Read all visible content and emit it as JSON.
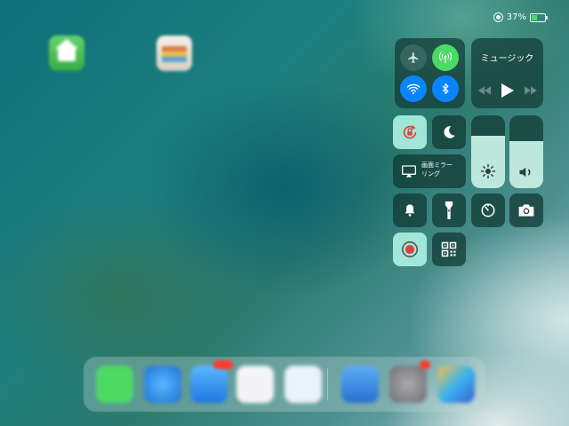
{
  "status_bar": {
    "battery_percent": "37%",
    "battery_level": 0.37,
    "orientation_lock_icon": "orientation-lock-icon",
    "battery_icon": "battery-icon"
  },
  "home_screen": {
    "apps": [
      {
        "name": "Home",
        "icon": "home-app-icon"
      },
      {
        "name": "Wallet",
        "icon": "wallet-app-icon"
      }
    ]
  },
  "control_center": {
    "connectivity": {
      "airplane": {
        "icon": "airplane-icon",
        "on": false
      },
      "cellular": {
        "icon": "cellular-antenna-icon",
        "on": true,
        "color": "#4cd964"
      },
      "wifi": {
        "icon": "wifi-icon",
        "on": true,
        "color": "#0a84ff"
      },
      "bluetooth": {
        "icon": "bluetooth-icon",
        "on": true,
        "color": "#0a84ff"
      }
    },
    "music": {
      "title": "ミュージック",
      "controls": [
        "rewind-icon",
        "play-icon",
        "fast-forward-icon"
      ]
    },
    "orientation_lock": {
      "icon": "rotation-lock-icon",
      "on": true
    },
    "do_not_disturb": {
      "icon": "moon-icon",
      "on": false
    },
    "screen_mirroring": {
      "label": "画面ミラーリング",
      "line1": "画面ミラー",
      "line2": "リング",
      "icon": "screen-mirroring-icon"
    },
    "brightness": {
      "icon": "sun-icon",
      "level": 0.72
    },
    "volume": {
      "icon": "speaker-icon",
      "level": 0.65
    },
    "shortcuts": [
      {
        "icon": "bell-icon"
      },
      {
        "icon": "flashlight-icon"
      },
      {
        "icon": "timer-icon"
      },
      {
        "icon": "camera-icon"
      },
      {
        "icon": "screen-record-icon",
        "on": true
      },
      {
        "icon": "qr-code-icon"
      }
    ],
    "accent_active": "#aaf0e1"
  },
  "dock": {
    "apps": [
      {
        "name": "Messages",
        "color": "#4cd964"
      },
      {
        "name": "Safari",
        "color": "#1e90ff"
      },
      {
        "name": "Mail",
        "color": "#2f8fe6",
        "badge": true
      },
      {
        "name": "Music",
        "color": "#f5f5f5"
      },
      {
        "name": "Files",
        "color": "#e8f1f8"
      },
      {
        "name": "Tweetbot",
        "color": "#3c8fe6"
      },
      {
        "name": "Settings",
        "color": "#8e8e93",
        "badge": true
      },
      {
        "name": "Photos",
        "color": "#3a7bd5"
      }
    ]
  }
}
